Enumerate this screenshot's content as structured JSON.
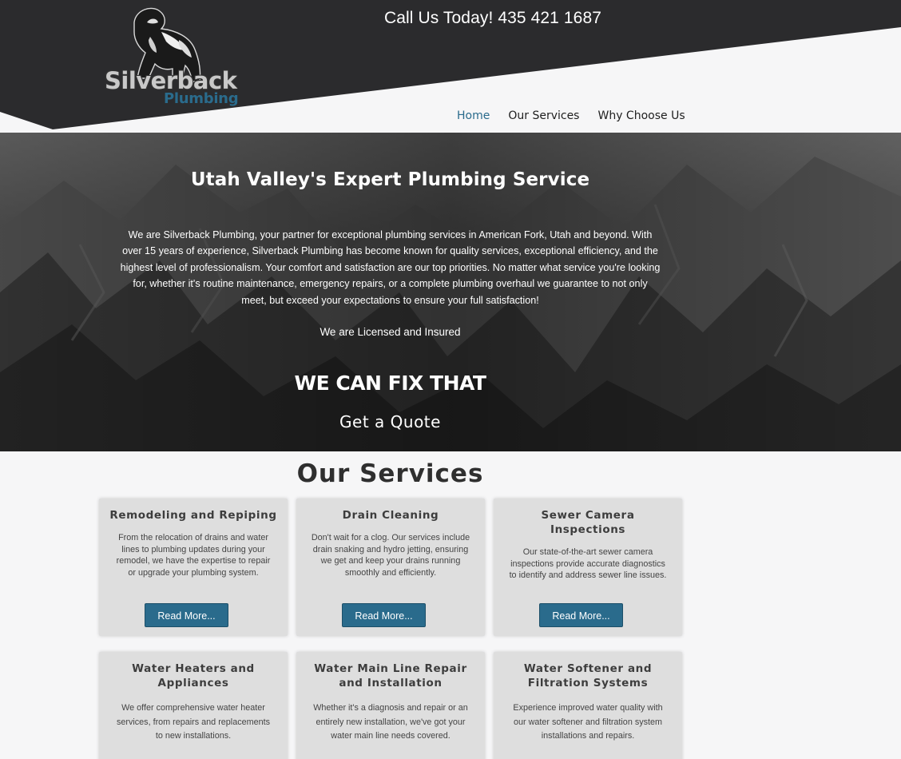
{
  "header": {
    "phone_text": "Call Us Today!  435 421 1687",
    "logo_line1": "Silverback",
    "logo_line2": "Plumbing",
    "nav": [
      {
        "label": "Home",
        "active": true
      },
      {
        "label": "Our Services",
        "active": false
      },
      {
        "label": "Why Choose Us",
        "active": false
      }
    ]
  },
  "hero": {
    "title": "Utah Valley's Expert Plumbing Service",
    "body": "We are Silverback Plumbing, your partner for exceptional plumbing services in American Fork, Utah and beyond. With over 15 years of experience, Silverback Plumbing has become known for quality services, exceptional efficiency, and the highest level of professionalism. Your comfort and satisfaction are our top priorities. No matter what service you're looking for, whether it's routine maintenance, emergency repairs, or a complete plumbing overhaul we guarantee to not only meet, but exceed your expectations to ensure your full satisfaction!",
    "licensed": "We are Licensed and Insured",
    "tagline": "WE CAN FIX THAT",
    "cta": "Get a Quote"
  },
  "services": {
    "title": "Our Services",
    "cards": [
      {
        "title": "Remodeling and Repiping",
        "text": "From the relocation of drains and water lines to plumbing updates during your remodel, we have the expertise to repair or upgrade your plumbing system.",
        "button": "Read More..."
      },
      {
        "title": "Drain Cleaning",
        "text": "Don't wait for a clog. Our services include drain snaking and hydro jetting, ensuring we get and keep your drains running smoothly and efficiently.",
        "button": "Read More..."
      },
      {
        "title": "Sewer Camera Inspections",
        "text": "Our state-of-the-art sewer camera inspections provide accurate diagnostics to identify and address sewer line issues.",
        "button": "Read More..."
      },
      {
        "title": "Water Heaters and Appliances",
        "text": "We offer comprehensive water heater services, from repairs and replacements to new installations."
      },
      {
        "title": "Water Main Line Repair and Installation",
        "text": "Whether it's a diagnosis and repair or an entirely new installation, we've got your water main line needs covered."
      },
      {
        "title": "Water Softener and Filtration Systems",
        "text": "Experience improved water quality with our water softener and filtration system installations and repairs."
      }
    ]
  },
  "colors": {
    "accent": "#2a6b8c",
    "header_dark": "#2b2b2d",
    "card_bg": "#dedede"
  },
  "icons": [
    "gorilla-logo-icon"
  ]
}
